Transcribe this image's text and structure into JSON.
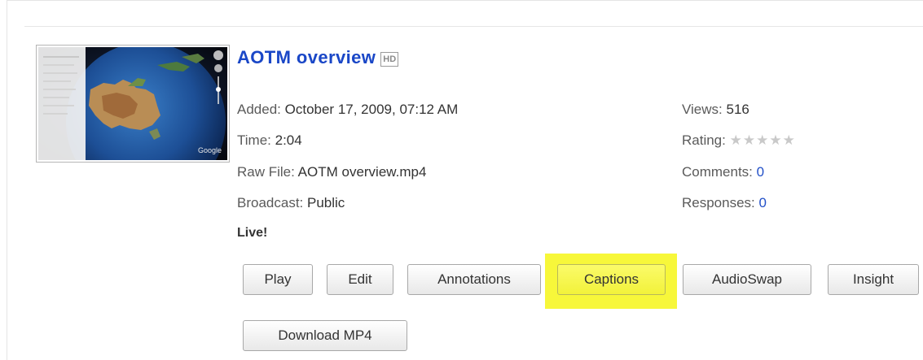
{
  "video": {
    "title": "AOTM overview",
    "hd_badge": "HD",
    "added_label": "Added:",
    "added_value": "October 17, 2009, 07:12 AM",
    "time_label": "Time:",
    "time_value": "2:04",
    "raw_file_label": "Raw File:",
    "raw_file_value": "AOTM overview.mp4",
    "broadcast_label": "Broadcast:",
    "broadcast_value": "Public",
    "views_label": "Views:",
    "views_value": "516",
    "rating_label": "Rating:",
    "rating_stars": "★★★★★",
    "comments_label": "Comments:",
    "comments_value": "0",
    "responses_label": "Responses:",
    "responses_value": "0",
    "status": "Live!"
  },
  "actions": {
    "play": "Play",
    "edit": "Edit",
    "annotations": "Annotations",
    "captions": "Captions",
    "audioswap": "AudioSwap",
    "insight": "Insight",
    "download": "Download MP4"
  },
  "thumbnail": {
    "watermark": "Google"
  },
  "colors": {
    "title_link": "#1a47c7",
    "link": "#2250c8",
    "highlight": "#f7f73a"
  }
}
